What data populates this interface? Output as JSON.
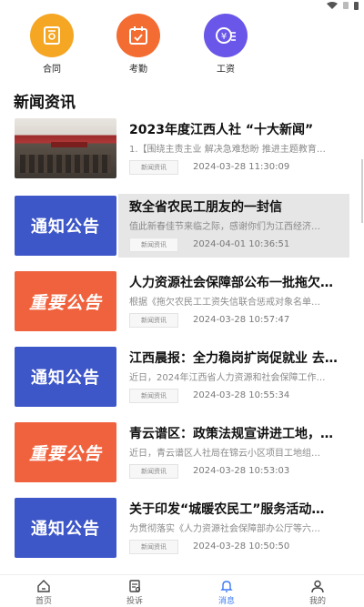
{
  "quick_links": [
    {
      "label": "合同",
      "icon": "contract-icon",
      "color": "#f5a623"
    },
    {
      "label": "考勤",
      "icon": "attendance-icon",
      "color": "#f36c32"
    },
    {
      "label": "工资",
      "icon": "salary-icon",
      "color": "#6a56e8"
    }
  ],
  "section_title": "新闻资讯",
  "news": [
    {
      "title": "2023年度江西人社 “十大新闻”",
      "summary": "1.【围绕主责主业 解决急难愁盼 推进主题教育…",
      "tag": "新闻资讯",
      "time": "2024-03-28 11:30:09",
      "thumb_text": ""
    },
    {
      "title": "致全省农民工朋友的一封信",
      "summary": "值此新春佳节来临之际，感谢你们为江西经济…",
      "tag": "新闻资讯",
      "time": "2024-04-01 10:36:51",
      "thumb_text": "通知公告"
    },
    {
      "title": "人力资源社会保障部公布一批拖欠…",
      "summary": "根据《拖欠农民工工资失信联合惩戒对象名单…",
      "tag": "新闻资讯",
      "time": "2024-03-28 10:57:47",
      "thumb_text": "重要公告"
    },
    {
      "title": "江西晨报：全力稳岗扩岗促就业 去…",
      "summary": "近日，2024年江西省人力资源和社会保障工作…",
      "tag": "新闻资讯",
      "time": "2024-03-28 10:55:34",
      "thumb_text": "通知公告"
    },
    {
      "title": "青云谱区：政策法规宣讲进工地，…",
      "summary": "近日，青云谱区人社局在锦云小区项目工地组…",
      "tag": "新闻资讯",
      "time": "2024-03-28 10:53:03",
      "thumb_text": "重要公告"
    },
    {
      "title": "关于印发“城暖农民工”服务活动…",
      "summary": "为贯彻落实《人力资源社会保障部办公厅等六…",
      "tag": "新闻资讯",
      "time": "2024-03-28 10:50:50",
      "thumb_text": "通知公告"
    }
  ],
  "tabs": [
    {
      "label": "首页",
      "icon": "home-icon"
    },
    {
      "label": "投诉",
      "icon": "complaint-icon"
    },
    {
      "label": "消息",
      "icon": "bell-icon"
    },
    {
      "label": "我的",
      "icon": "user-icon"
    }
  ],
  "active_tab": "消息",
  "colors": {
    "accent_blue": "#3d56c8",
    "accent_orange": "#f0623e",
    "tab_active": "#3d7bf5"
  }
}
